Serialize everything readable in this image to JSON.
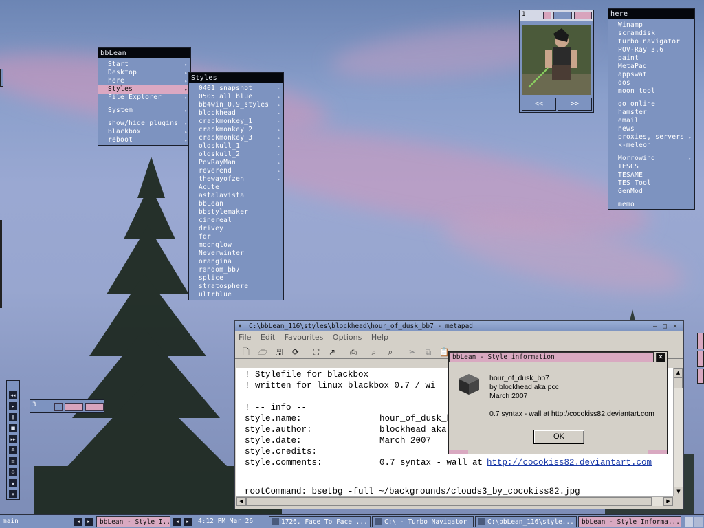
{
  "colors": {
    "accent_pink": "#d9a9c1",
    "menu_blue": "#7d93c0",
    "title_black": "#05070c",
    "link_blue": "#1a3aa8"
  },
  "bblean_menu": {
    "title": "bbLean",
    "items": [
      {
        "label": "Start",
        "submenu": true
      },
      {
        "label": "Desktop",
        "submenu": true
      },
      {
        "label": "here",
        "submenu": true
      },
      {
        "label": "Styles",
        "submenu": true,
        "selected": true
      },
      {
        "label": "File Explorer",
        "submenu": true
      },
      {
        "label": "System",
        "submenu": true
      },
      {
        "label": "show/hide plugins",
        "submenu": true
      },
      {
        "label": "Blackbox",
        "submenu": true
      },
      {
        "label": "reboot",
        "submenu": true
      }
    ]
  },
  "styles_menu": {
    "title": "Styles",
    "items": [
      "0401 snapshot",
      "0505 all blue",
      "bb4win_0.9_styles",
      "blockhead",
      "crackmonkey_1",
      "crackmonkey_2",
      "crackmonkey_3",
      "oldskull_1",
      "oldskull_2",
      "PovRayMan",
      "reverend",
      "thewayofzen",
      "Acute",
      "astalavista",
      "bbLean",
      "bbstylemaker",
      "cinereal",
      "drivey",
      "fqr",
      "moonglow",
      "Neverwinter",
      "orangina",
      "random_bb7",
      "splice",
      "stratosphere",
      "ultrblue"
    ],
    "submenu_count": 12
  },
  "here_menu": {
    "title": "here",
    "groups": [
      [
        "Winamp",
        "scramdisk",
        "turbo navigator",
        "POV-Ray 3.6",
        "paint",
        "MetaPad",
        "appswat",
        "dos",
        "moon tool"
      ],
      [
        "go online",
        "hamster",
        "email",
        "news",
        "proxies, servers",
        "k-meleon"
      ],
      [
        "Morrowind",
        "TESCS",
        "TESAME",
        "TES Tool",
        "GenMod"
      ],
      [
        "memo"
      ]
    ]
  },
  "picture_widget": {
    "label": "1",
    "prev_label": "<<",
    "next_label": ">>"
  },
  "workspace_widget": {
    "label": "3"
  },
  "metapad": {
    "title": "C:\\bbLean_116\\styles\\blockhead\\hour_of_dusk_bb7 - metapad",
    "menu": [
      "File",
      "Edit",
      "Favourites",
      "Options",
      "Help"
    ],
    "lines": [
      {
        "key": "! Stylefile for blackbox",
        "val": ""
      },
      {
        "key": "! written for linux blackbox 0.7 / wi",
        "val": ""
      },
      {
        "key": "",
        "val": ""
      },
      {
        "key": "! -- info --",
        "val": ""
      },
      {
        "key": "style.name:",
        "val": "hour_of_dusk_bb"
      },
      {
        "key": "style.author:",
        "val": "blockhead aka p"
      },
      {
        "key": "style.date:",
        "val": "March 2007"
      },
      {
        "key": "style.credits:",
        "val": ""
      },
      {
        "key": "style.comments:",
        "val": "0.7 syntax - wall at "
      }
    ],
    "link": "http://cocokiss82.deviantart.com",
    "root_command": "rootCommand: bsetbg -full ~/backgrounds/clouds3_by_cocokiss82.jpg"
  },
  "style_info": {
    "title": "bbLean - Style information",
    "name": "hour_of_dusk_bb7",
    "author": "by blockhead aka pcc",
    "date": "March 2007",
    "comment": "0.7 syntax - wall at http://cocokiss82.deviantart.com",
    "ok_label": "OK"
  },
  "taskbar": {
    "workspace": "main",
    "active_task": "bbLean - Style I...",
    "clock": "4:12 PM Mar 26",
    "tasks": [
      "1726. Face To Face ...",
      "C:\\ - Turbo Navigator",
      "C:\\bbLean_116\\style...",
      "bbLean - Style Informa..."
    ]
  }
}
